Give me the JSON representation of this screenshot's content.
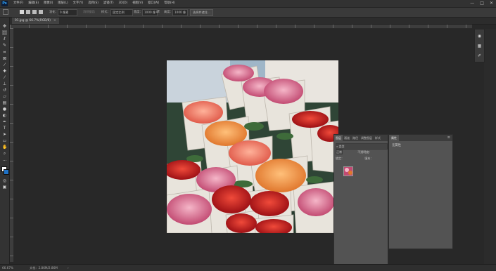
{
  "app": {
    "logo": "Ps"
  },
  "menu": [
    "文件(F)",
    "编辑(E)",
    "图像(I)",
    "图层(L)",
    "文字(Y)",
    "选择(S)",
    "滤镜(T)",
    "3D(D)",
    "视图(V)",
    "窗口(W)",
    "帮助(H)"
  ],
  "window_controls": [
    "—",
    "□",
    "✕"
  ],
  "options": {
    "feather_label": "羽化：",
    "feather_value": "0 像素",
    "antialias_label": "消除锯齿",
    "style_label": "样式：",
    "style_value": "固定比例",
    "width_label": "宽度：",
    "width_value": "1000 像",
    "swap_icon": "⇄",
    "height_label": "高度：",
    "height_value": "1000 像",
    "select_mask_button": "选择并遮住..."
  },
  "document_tab": {
    "title": "01.jpg @ 66.7%(RGB/8)",
    "close": "×"
  },
  "layers_panel": {
    "tabs": [
      "图层",
      "通道",
      "路径",
      "调整图层",
      "样式"
    ],
    "active_tab": "图层",
    "kind_label": "类型",
    "blend_mode": "正常",
    "opacity_label": "不透明度：",
    "lock_label": "锁定：",
    "fill_label": "填充："
  },
  "properties_panel": {
    "tab": "属性",
    "label": "无属性",
    "menu": "≡"
  },
  "status": {
    "zoom": "66.67%",
    "doc_info": "文档：2.86M/2.86M",
    "arrow": "›"
  },
  "icons": {
    "tools": [
      "move-icon",
      "marquee-icon",
      "lasso-icon",
      "quick-select-icon",
      "crop-icon",
      "frame-icon",
      "eyedropper-icon",
      "healing-icon",
      "brush-icon",
      "stamp-icon",
      "history-brush-icon",
      "eraser-icon",
      "gradient-icon",
      "blur-icon",
      "dodge-icon",
      "pen-icon",
      "type-icon",
      "path-select-icon",
      "shape-icon",
      "hand-icon",
      "zoom-icon",
      "more-tools-icon"
    ]
  },
  "colors": {
    "foreground": "#ffffff",
    "background": "#1f73c8",
    "accent": "#31a8ff"
  }
}
